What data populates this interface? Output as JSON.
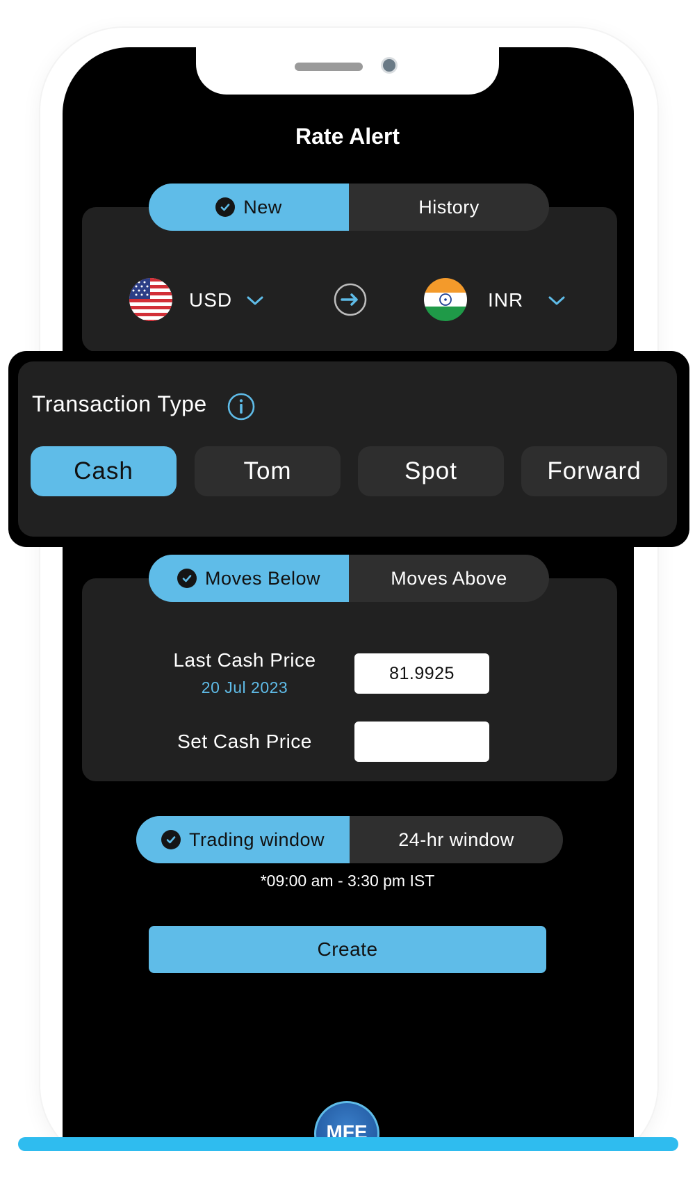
{
  "header": {
    "title": "Rate Alert"
  },
  "mode_toggle": {
    "options": [
      "New",
      "History"
    ],
    "selected": "New"
  },
  "currency": {
    "from": {
      "code": "USD",
      "flag": "us-flag-icon"
    },
    "to": {
      "code": "INR",
      "flag": "india-flag-icon"
    }
  },
  "transaction": {
    "label": "Transaction Type",
    "options": [
      "Cash",
      "Tom",
      "Spot",
      "Forward"
    ],
    "selected": "Cash"
  },
  "direction_toggle": {
    "options": [
      "Moves Below",
      "Moves Above"
    ],
    "selected": "Moves Below"
  },
  "price": {
    "last_label": "Last Cash Price",
    "last_date": "20 Jul 2023",
    "last_value": "81.9925",
    "set_label": "Set Cash Price",
    "set_value": ""
  },
  "window_toggle": {
    "options": [
      "Trading window",
      "24-hr window"
    ],
    "selected": "Trading window"
  },
  "window_note": "*09:00 am - 3:30 pm IST",
  "actions": {
    "create_label": "Create"
  },
  "brand": {
    "logo_text": "MFE"
  },
  "colors": {
    "accent": "#5fbce8",
    "card": "#212121",
    "background": "#000000"
  }
}
